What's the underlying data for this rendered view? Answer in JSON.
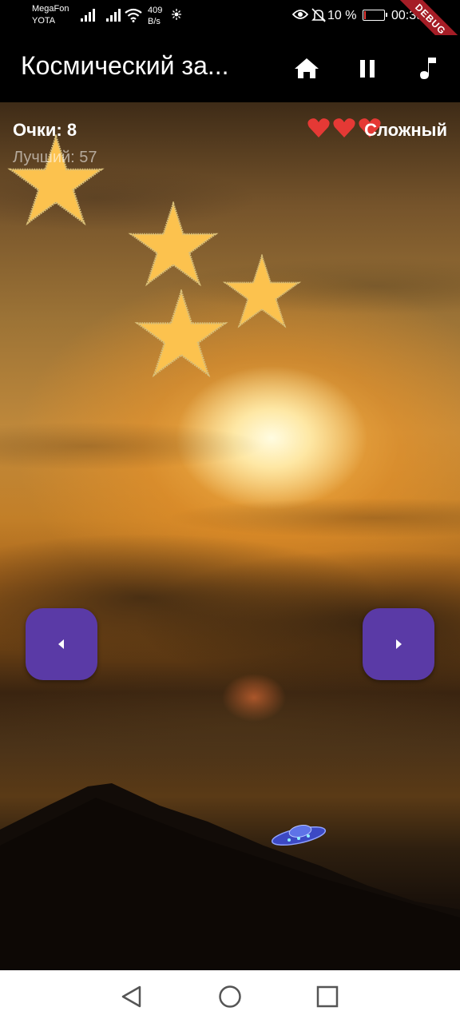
{
  "status_bar": {
    "carrier_1": "MegaFon",
    "carrier_2": "YOTA",
    "net_speed_value": "409",
    "net_speed_unit": "B/s",
    "battery_percent": "10 %",
    "battery_level": 0.1,
    "time": "00:39",
    "icons": [
      "signal-icon",
      "signal-icon",
      "wifi-icon",
      "sync-icon",
      "eye-icon",
      "mute-icon",
      "battery-icon"
    ]
  },
  "debug_banner": "DEBUG",
  "app_bar": {
    "title": "Космический за...",
    "actions": [
      "home-icon",
      "pause-icon",
      "music-icon"
    ]
  },
  "hud": {
    "score": "Очки: 8",
    "best": "Лучший: 57",
    "lives": 3,
    "difficulty": "Сложный"
  },
  "game": {
    "stars": 4,
    "controls": [
      "arrow-left-icon",
      "arrow-right-icon"
    ],
    "player": "ufo"
  },
  "nav_bar": {
    "buttons": [
      "back-icon",
      "home-circle-icon",
      "recents-icon"
    ]
  },
  "colors": {
    "control_button": "#5a3aa6",
    "heart": "#e53935",
    "star_fill": "#fcc24e"
  }
}
